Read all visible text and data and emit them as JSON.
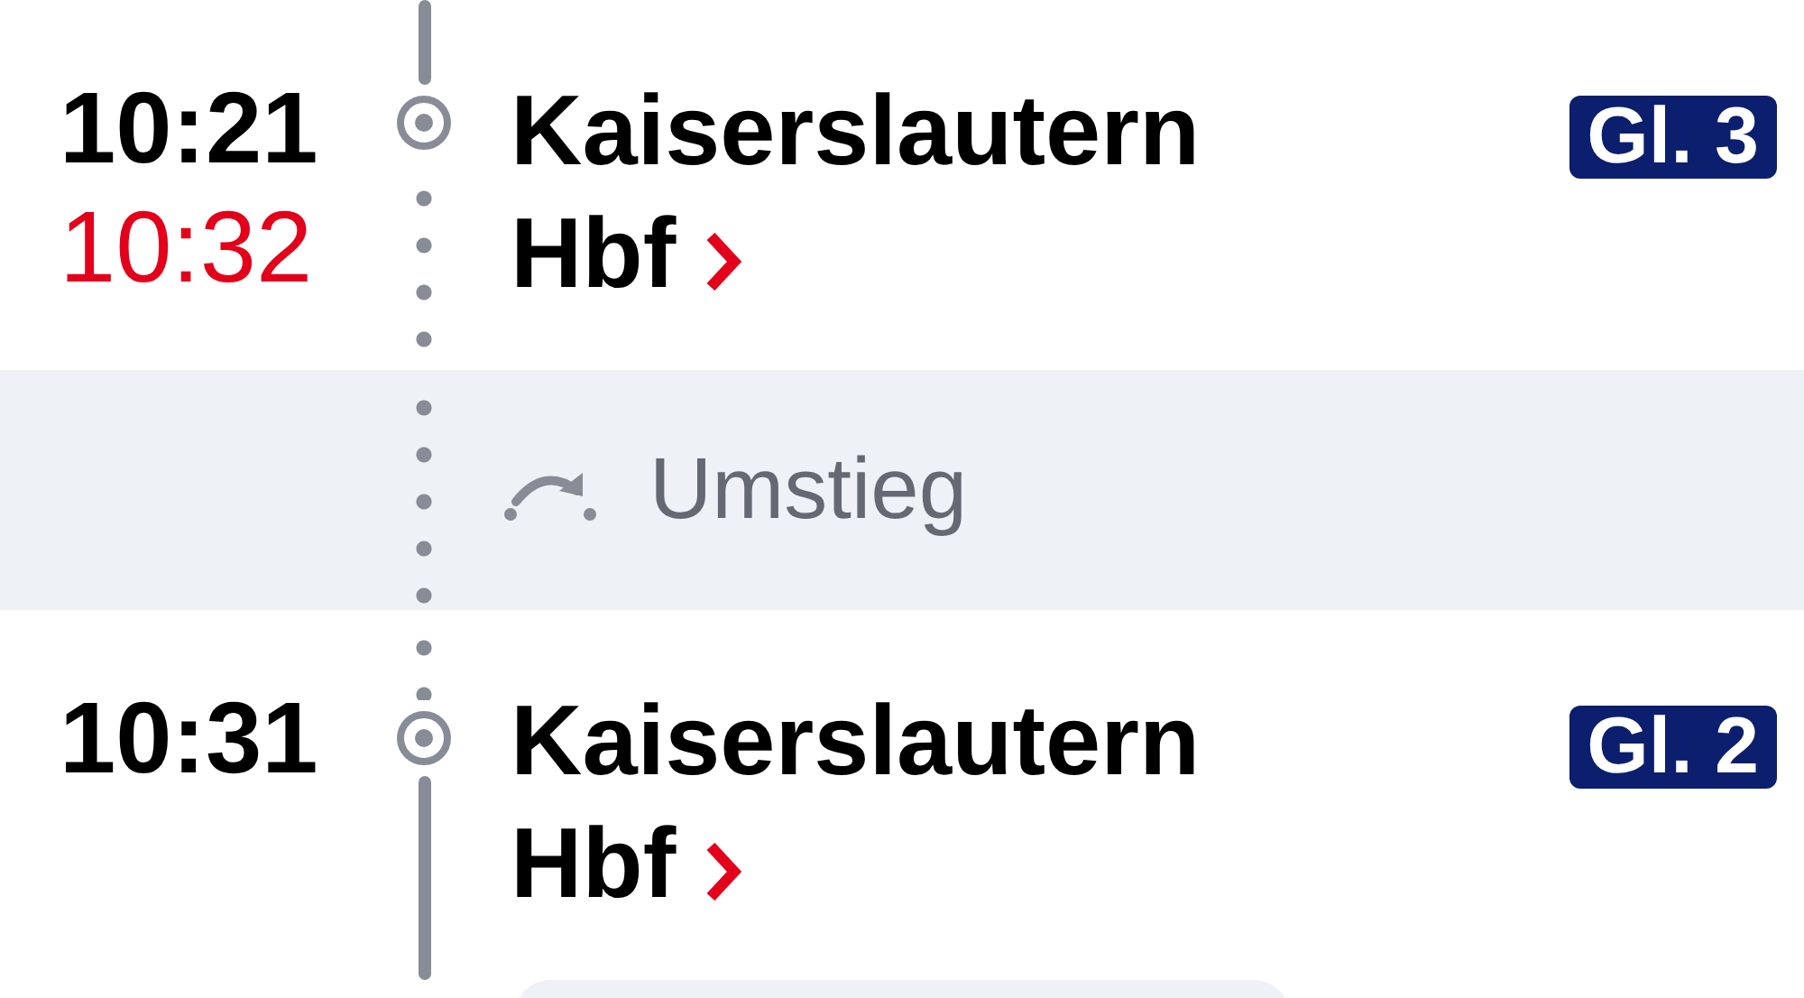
{
  "sections": [
    {
      "kind": "stop",
      "time": "10:21",
      "actual_time": "10:32",
      "station": "Kaiserslautern Hbf",
      "platform": "Gl. 3",
      "dotted_above": false,
      "dotted_below": true
    },
    {
      "kind": "transfer",
      "label": "Umstieg"
    },
    {
      "kind": "stop",
      "time": "10:31",
      "station": "Kaiserslautern Hbf",
      "platform": "Gl. 2",
      "dotted_above": true,
      "dotted_below": false
    }
  ]
}
